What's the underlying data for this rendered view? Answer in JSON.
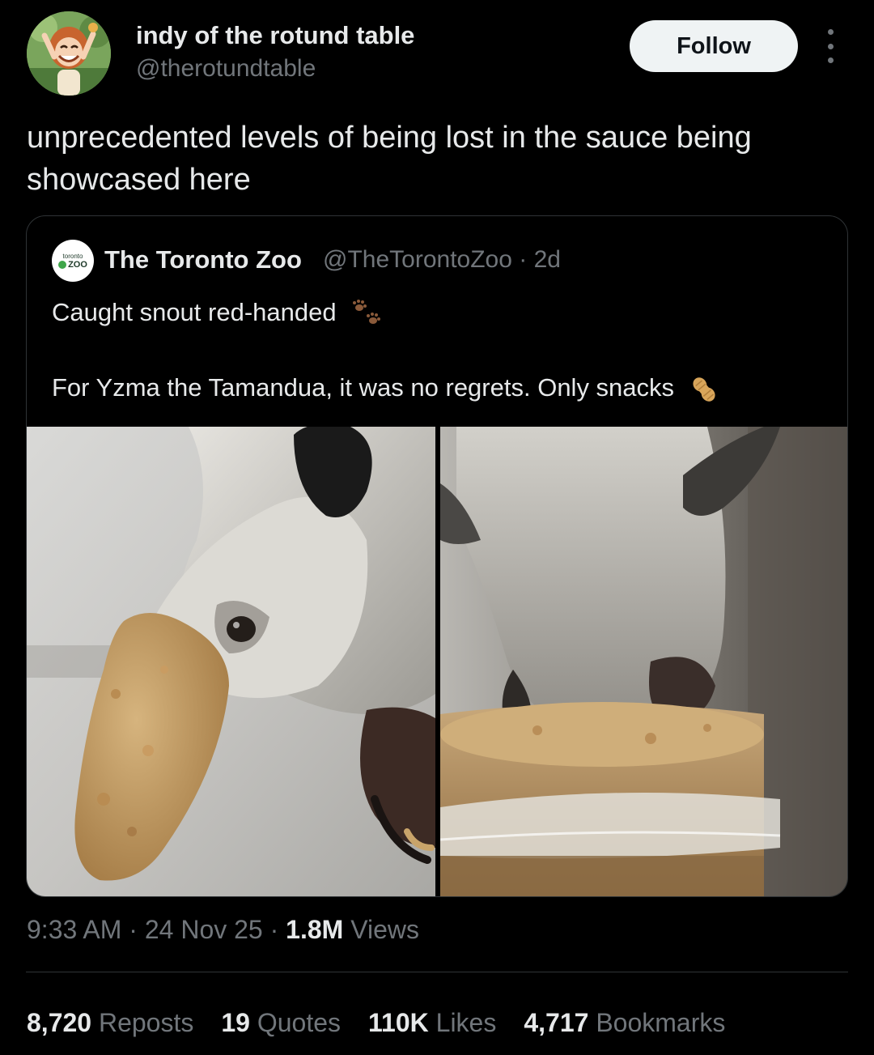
{
  "author": {
    "display_name": "indy of the rotund table",
    "handle": "@therotundtable",
    "follow_label": "Follow",
    "avatar_icon": "cartoon-character-avatar"
  },
  "tweet": {
    "text": "unprecedented levels of being lost in the sauce being showcased here"
  },
  "quote": {
    "name": "The Toronto Zoo",
    "handle_time": "@TheTorontoZoo · 2d",
    "avatar_text_top": "toronto",
    "avatar_text_bottom": "ZOO",
    "line1": "Caught snout red-handed",
    "line1_emoji": "paw-prints-emoji",
    "line2": "For Yzma the Tamandua, it was no regrets. Only snacks",
    "line2_emoji": "peanut-emoji",
    "photos": [
      {
        "subject": "tamandua-snout-covered-in-peanut-butter"
      },
      {
        "subject": "tamandua-eating-from-peanut-butter-jar"
      }
    ]
  },
  "meta": {
    "time": "9:33 AM",
    "date": "24 Nov 25",
    "views_count": "1.8M",
    "views_label": "Views"
  },
  "stats": [
    {
      "count": "8,720",
      "label": "Reposts"
    },
    {
      "count": "19",
      "label": "Quotes"
    },
    {
      "count": "110K",
      "label": "Likes"
    },
    {
      "count": "4,717",
      "label": "Bookmarks"
    }
  ],
  "colors": {
    "background": "#000000",
    "text_primary": "#e7e9ea",
    "text_secondary": "#71767b",
    "border": "#2f3336",
    "follow_bg": "#eff3f4"
  }
}
